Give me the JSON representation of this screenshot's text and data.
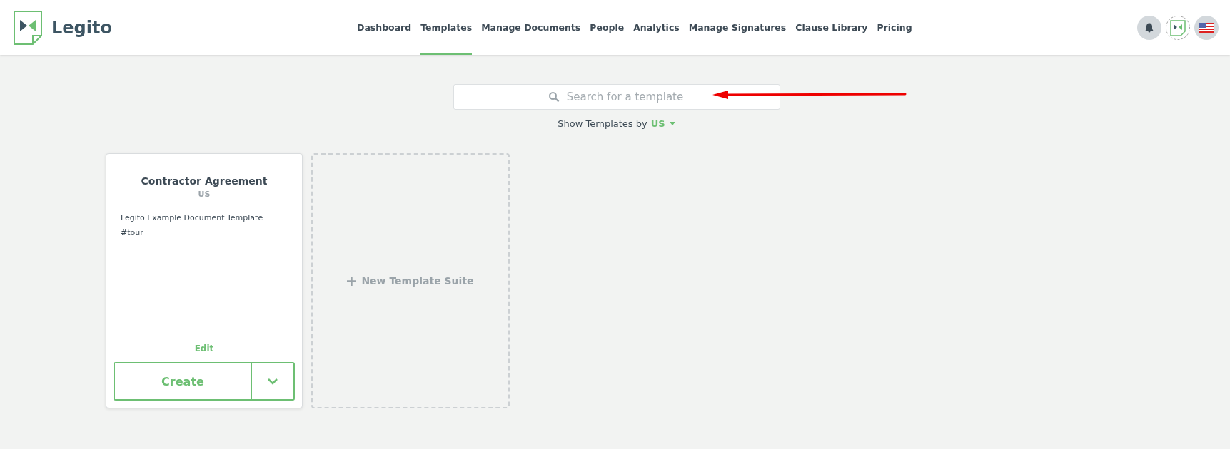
{
  "brand": {
    "name": "Legito"
  },
  "nav": [
    {
      "label": "Dashboard",
      "selected": false
    },
    {
      "label": "Templates",
      "selected": true
    },
    {
      "label": "Manage Documents",
      "selected": false
    },
    {
      "label": "People",
      "selected": false
    },
    {
      "label": "Analytics",
      "selected": false
    },
    {
      "label": "Manage Signatures",
      "selected": false
    },
    {
      "label": "Clause Library",
      "selected": false
    },
    {
      "label": "Pricing",
      "selected": false
    }
  ],
  "search": {
    "placeholder": "Search for a template"
  },
  "filter": {
    "label": "Show Templates by",
    "value": "US"
  },
  "templates": [
    {
      "title": "Contractor Agreement",
      "region": "US",
      "description": "Legito Example Document Template",
      "tags": "#tour",
      "edit": "Edit",
      "create": "Create"
    }
  ],
  "new_suite": {
    "label": "New Template Suite"
  }
}
